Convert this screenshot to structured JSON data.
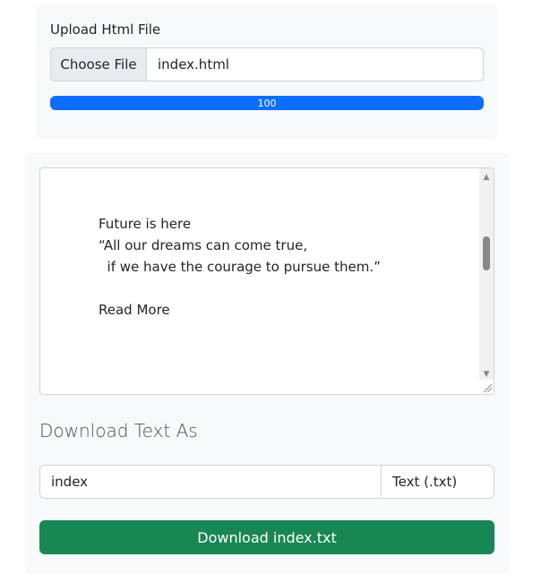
{
  "upload": {
    "label": "Upload Html File",
    "choose_button": "Choose File",
    "file_name": "index.html",
    "progress": 100,
    "progress_label": "100"
  },
  "preview": {
    "lines": [
      "Future is here",
      "“All our dreams can come true,",
      "  if we have the courage to pursue them.”",
      "",
      "Read More"
    ]
  },
  "download": {
    "title": "Download Text As",
    "file_name_value": "index",
    "extension_label": "Text (.txt)",
    "button_label": "Download index.txt"
  },
  "colors": {
    "progress": "#0d6efd",
    "download_button": "#198754"
  }
}
